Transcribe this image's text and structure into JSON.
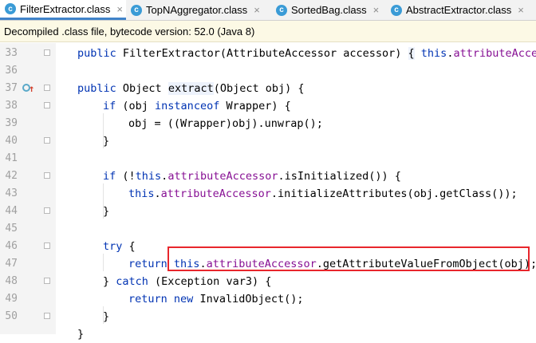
{
  "tabs": [
    {
      "label": "FilterExtractor.class",
      "active": true,
      "icon": "class-file-icon"
    },
    {
      "label": "TopNAggregator.class",
      "active": false,
      "icon": "class-file-icon"
    },
    {
      "label": "SortedBag.class",
      "active": false,
      "icon": "class-file-icon"
    },
    {
      "label": "AbstractExtractor.class",
      "active": false,
      "icon": "class-file-icon"
    }
  ],
  "tab_icon_glyph": "c",
  "tab_close_glyph": "×",
  "banner": "Decompiled .class file, bytecode version: 52.0 (Java 8)",
  "line_numbers": [
    "33",
    "36",
    "37",
    "38",
    "39",
    "40",
    "41",
    "42",
    "43",
    "44",
    "45",
    "46",
    "47",
    "48",
    "49",
    "50"
  ],
  "code": {
    "l33": {
      "a": "public",
      "b": " FilterExtractor(AttributeAccessor accessor) ",
      "c": "{",
      "d": " this",
      "e": ".",
      "f": "attributeAccess"
    },
    "l37": {
      "a": "public",
      "b": " Object ",
      "c": "extract",
      "d": "(Object obj) {"
    },
    "l38": {
      "a": "if",
      "b": " (obj ",
      "c": "instanceof",
      "d": " Wrapper) {"
    },
    "l39": {
      "a": "obj = ((Wrapper)obj).unwrap();"
    },
    "l40": {
      "a": "}"
    },
    "l42": {
      "a": "if",
      "b": " (!",
      "c": "this",
      "d": ".",
      "e": "attributeAccessor",
      "f": ".isInitialized()) {"
    },
    "l43": {
      "a": "this",
      "b": ".",
      "c": "attributeAccessor",
      "d": ".initializeAttributes(obj.getClass());"
    },
    "l44": {
      "a": "}"
    },
    "l46": {
      "a": "try",
      "b": " {"
    },
    "l47": {
      "a": "return",
      "b": " ",
      "c": "this",
      "d": ".",
      "e": "attributeAccessor",
      "f": ".getAttributeValueFromObject(obj);"
    },
    "l48": {
      "a": "} ",
      "b": "catch",
      "c": " (Exception var3) {"
    },
    "l49": {
      "a": "return",
      "b": " ",
      "c": "new",
      "d": " InvalidObject();"
    },
    "l50": {
      "a": "}"
    },
    "l51": {
      "a": "}"
    }
  },
  "gutter_icons": {
    "override": "method-override-icon",
    "up": "up-arrow-icon",
    "up_glyph": "↑"
  },
  "colors": {
    "keyword": "#0033b3",
    "field": "#871094",
    "highlight_box": "#e8262c",
    "active_tab_underline": "#4083c9"
  }
}
